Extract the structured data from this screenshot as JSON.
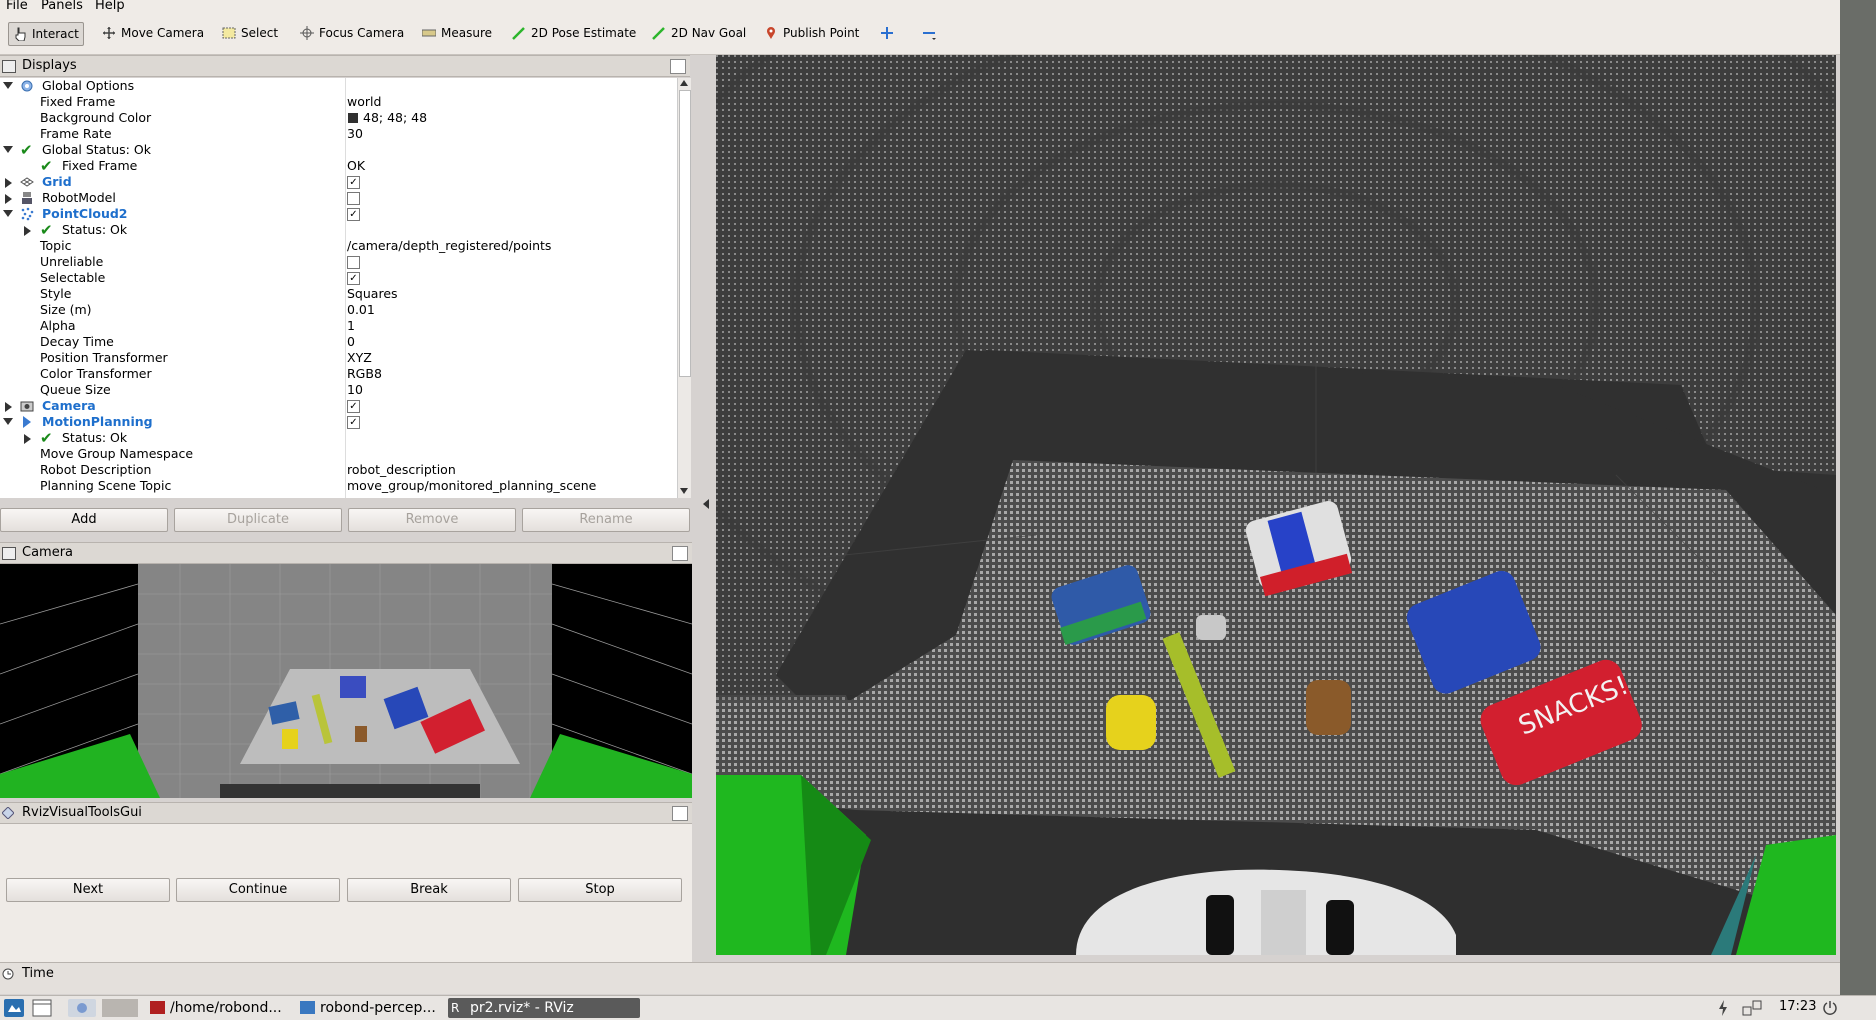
{
  "menu": [
    "File",
    "Panels",
    "Help"
  ],
  "toolbar": {
    "interact": "Interact",
    "move_camera": "Move Camera",
    "select": "Select",
    "focus_camera": "Focus Camera",
    "measure": "Measure",
    "pose_estimate": "2D Pose Estimate",
    "nav_goal": "2D Nav Goal",
    "publish_point": "Publish Point"
  },
  "displays": {
    "title": "Displays",
    "rows": [
      {
        "label": "Global Options",
        "value": ""
      },
      {
        "label": "Fixed Frame",
        "value": "world"
      },
      {
        "label": "Background Color",
        "value": "48; 48; 48"
      },
      {
        "label": "Frame Rate",
        "value": "30"
      },
      {
        "label": "Global Status: Ok",
        "value": ""
      },
      {
        "label": "Fixed Frame",
        "value": "OK"
      },
      {
        "label": "Grid",
        "value": ""
      },
      {
        "label": "RobotModel",
        "value": ""
      },
      {
        "label": "PointCloud2",
        "value": ""
      },
      {
        "label": "Status: Ok",
        "value": ""
      },
      {
        "label": "Topic",
        "value": "/camera/depth_registered/points"
      },
      {
        "label": "Unreliable",
        "value": ""
      },
      {
        "label": "Selectable",
        "value": ""
      },
      {
        "label": "Style",
        "value": "Squares"
      },
      {
        "label": "Size (m)",
        "value": "0.01"
      },
      {
        "label": "Alpha",
        "value": "1"
      },
      {
        "label": "Decay Time",
        "value": "0"
      },
      {
        "label": "Position Transformer",
        "value": "XYZ"
      },
      {
        "label": "Color Transformer",
        "value": "RGB8"
      },
      {
        "label": "Queue Size",
        "value": "10"
      },
      {
        "label": "Camera",
        "value": ""
      },
      {
        "label": "MotionPlanning",
        "value": ""
      },
      {
        "label": "Status: Ok",
        "value": ""
      },
      {
        "label": "Move Group Namespace",
        "value": ""
      },
      {
        "label": "Robot Description",
        "value": "robot_description"
      },
      {
        "label": "Planning Scene Topic",
        "value": "move_group/monitored_planning_scene"
      }
    ],
    "buttons": {
      "add": "Add",
      "duplicate": "Duplicate",
      "remove": "Remove",
      "rename": "Rename"
    }
  },
  "camera_panel": {
    "title": "Camera"
  },
  "rviz_tools": {
    "title": "RvizVisualToolsGui",
    "buttons": {
      "next": "Next",
      "continue": "Continue",
      "break": "Break",
      "stop": "Stop"
    }
  },
  "time_panel": {
    "title": "Time"
  },
  "viewport": {
    "box_label": "SNACKS!"
  },
  "taskbar": {
    "items": [
      "/home/robond...",
      "robond-percep...",
      "pr2.rviz* - RViz"
    ],
    "clock": "17:23"
  },
  "colors": {
    "background": "#303030",
    "accent": "#1e6fcc",
    "ok": "#1a8a1a"
  }
}
